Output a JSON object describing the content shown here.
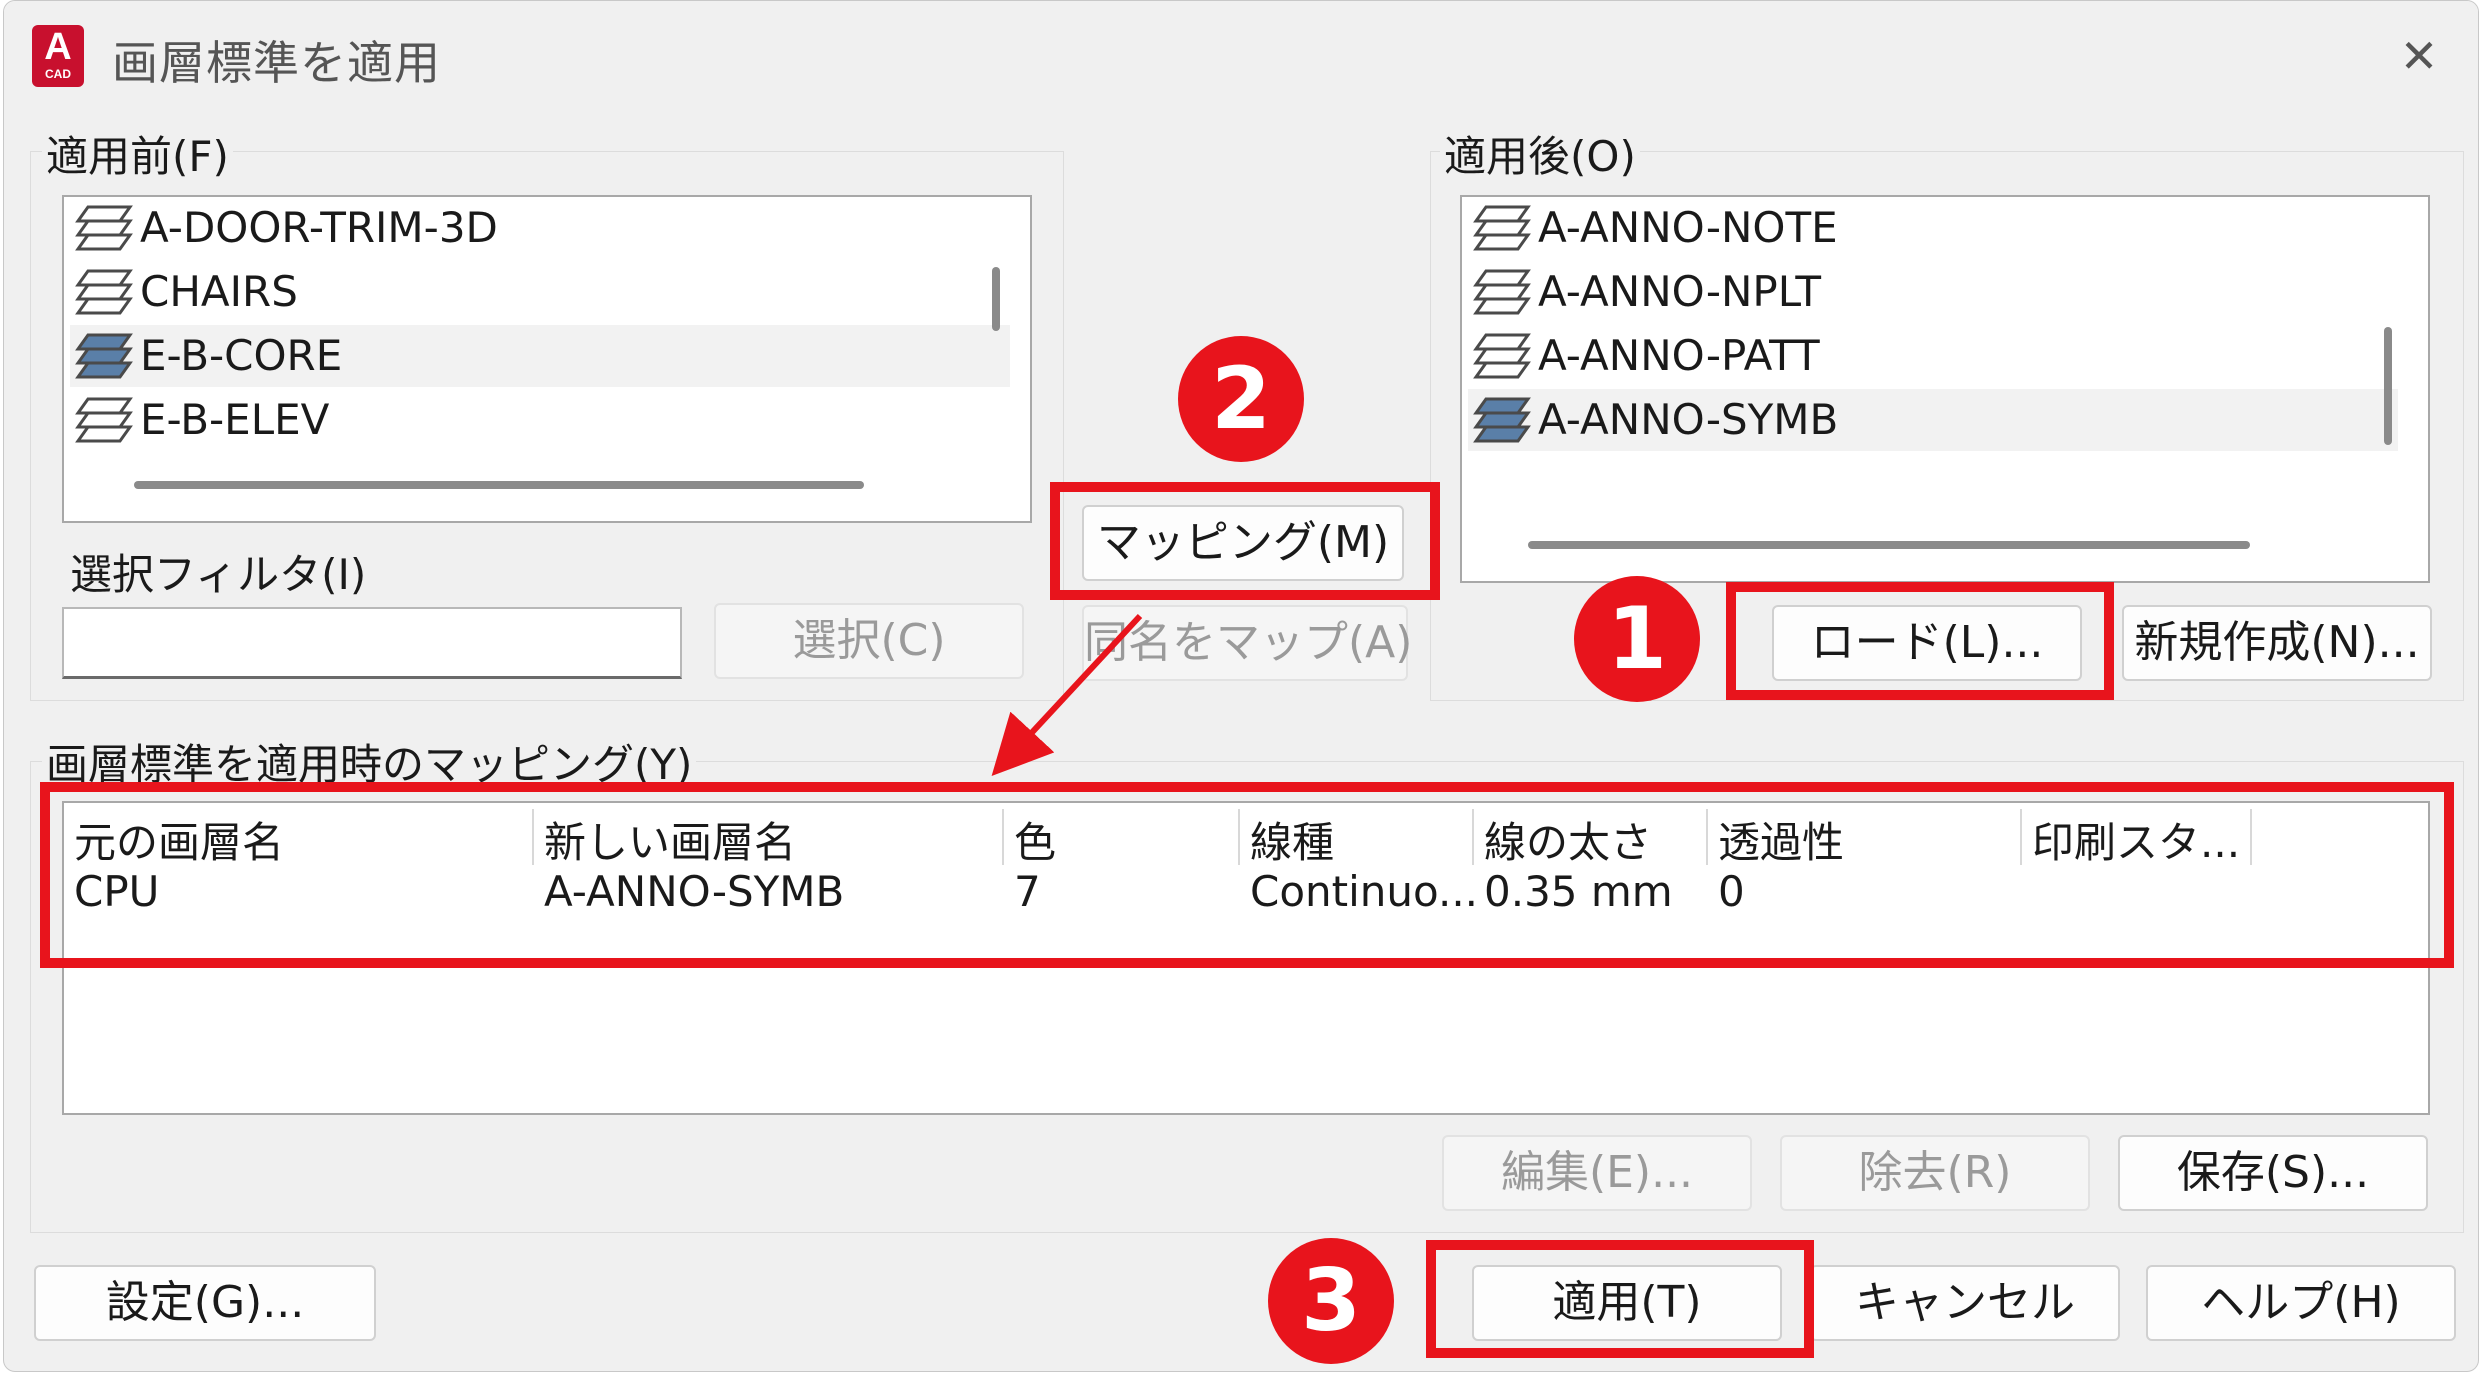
{
  "window": {
    "title": "画層標準を適用",
    "app_icon_letter": "A",
    "app_icon_sub": "CAD",
    "close_glyph": "✕"
  },
  "before": {
    "label": "適用前(F)",
    "layers": [
      {
        "name": "A-DOOR-TRIM-3D",
        "selected": false
      },
      {
        "name": "CHAIRS",
        "selected": false
      },
      {
        "name": "E-B-CORE",
        "selected": true
      },
      {
        "name": "E-B-ELEV",
        "selected": false
      }
    ],
    "filter_label": "選択フィルタ(I)",
    "filter_value": "",
    "select_button": "選択(C)"
  },
  "after": {
    "label": "適用後(O)",
    "layers": [
      {
        "name": "A-ANNO-NOTE",
        "selected": false
      },
      {
        "name": "A-ANNO-NPLT",
        "selected": false
      },
      {
        "name": "A-ANNO-PATT",
        "selected": false
      },
      {
        "name": "A-ANNO-SYMB",
        "selected": true
      }
    ],
    "load_button": "ロード(L)...",
    "new_button": "新規作成(N)..."
  },
  "middle": {
    "mapping_button": "マッピング(M)",
    "map_same_button": "同名をマップ(A)"
  },
  "mappings": {
    "label": "画層標準を適用時のマッピング(Y)",
    "columns": [
      "元の画層名",
      "新しい画層名",
      "色",
      "線種",
      "線の太さ",
      "透過性",
      "印刷スタ..."
    ],
    "rows": [
      [
        "CPU",
        "A-ANNO-SYMB",
        "7",
        "Continuo...",
        "0.35 mm",
        "0",
        ""
      ]
    ],
    "edit_button": "編集(E)...",
    "remove_button": "除去(R)",
    "save_button": "保存(S)..."
  },
  "footer": {
    "settings_button": "設定(G)...",
    "apply_button": "適用(T)",
    "cancel_button": "キャンセル",
    "help_button": "ヘルプ(H)"
  },
  "annotations": {
    "badge_1": "1",
    "badge_2": "2",
    "badge_3": "3",
    "highlight_color": "#e8141c"
  },
  "colors": {
    "dialog_bg": "#f0f0f0",
    "list_bg": "#ffffff",
    "selected_layer_icon": "#5a7fa8"
  }
}
